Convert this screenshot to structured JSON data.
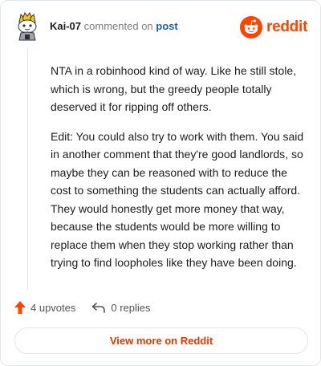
{
  "comment": {
    "author": "Kai-07",
    "action_text": "commented on",
    "post_link": "post",
    "paragraphs": [
      "NTA in a robinhood kind of way. Like he still stole, which is wrong, but the greedy people totally deserved it for ripping off others.",
      "Edit: You could also try to work with them. You said in another comment that they're good landlords, so maybe they can be reasoned with to reduce the cost to something the students can actually afford. They would honestly get more money that way, because the students would be more willing to replace them when they stop working rather than trying to find loopholes like they have been doing."
    ]
  },
  "brand": {
    "name": "reddit",
    "icon": "reddit-logo-icon",
    "color": "#ff4500"
  },
  "stats": {
    "upvotes": "4 upvotes",
    "replies": "0 replies",
    "upvote_icon": "upvote-arrow-icon",
    "reply_icon": "reply-arrow-icon"
  },
  "actions": {
    "view_more": "View more on Reddit"
  },
  "colors": {
    "accent": "#ff4500",
    "link": "#1a5fb4",
    "button_text": "#d93a00"
  }
}
